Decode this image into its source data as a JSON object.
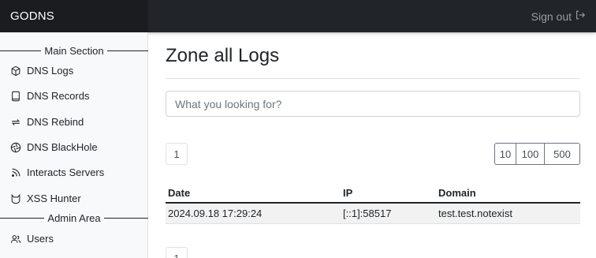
{
  "brand": "GODNS",
  "header": {
    "signout_label": "Sign out"
  },
  "sidebar": {
    "main_section_label": "Main Section",
    "admin_section_label": "Admin Area",
    "items": [
      {
        "label": "DNS Logs",
        "icon": "box-icon"
      },
      {
        "label": "DNS Records",
        "icon": "book-icon"
      },
      {
        "label": "DNS Rebind",
        "icon": "arrows-repeat-icon"
      },
      {
        "label": "DNS BlackHole",
        "icon": "aperture-icon"
      },
      {
        "label": "Interacts Servers",
        "icon": "rss-icon"
      },
      {
        "label": "XSS Hunter",
        "icon": "cat-icon"
      }
    ],
    "admin_items": [
      {
        "label": "Users",
        "icon": "users-icon"
      }
    ]
  },
  "main": {
    "title": "Zone all Logs",
    "search_placeholder": "What you looking for?",
    "pagination": {
      "current_page": "1"
    },
    "page_sizes": [
      "10",
      "100",
      "500"
    ],
    "table": {
      "columns": [
        "Date",
        "IP",
        "Domain"
      ],
      "rows": [
        {
          "date": "2024.09.18 17:29:24",
          "ip": "[::1]:58517",
          "domain": "test.test.notexist"
        }
      ]
    }
  }
}
